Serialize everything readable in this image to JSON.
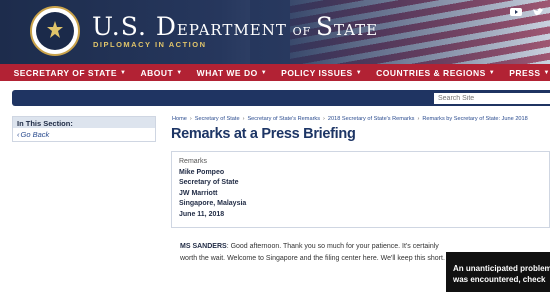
{
  "header": {
    "title_main_1": "U.S. D",
    "title_main_2": "EPARTMENT ",
    "title_of": "OF ",
    "title_state_1": "S",
    "title_state_2": "TATE",
    "tagline": "DIPLOMACY IN ACTION",
    "social_icons": [
      "youtube-icon",
      "twitter-icon"
    ]
  },
  "nav": {
    "items": [
      {
        "label": "SECRETARY OF STATE"
      },
      {
        "label": "ABOUT"
      },
      {
        "label": "WHAT WE DO"
      },
      {
        "label": "POLICY ISSUES"
      },
      {
        "label": "COUNTRIES & REGIONS"
      },
      {
        "label": "PRESS"
      }
    ]
  },
  "search": {
    "placeholder": "Search Site"
  },
  "sidebar": {
    "heading": "In This Section:",
    "back_label": "Go Back"
  },
  "breadcrumb": [
    "Home",
    "Secretary of State",
    "Secretary of State's Remarks",
    "2018 Secretary of State's Remarks",
    "Remarks by Secretary of State: June 2018"
  ],
  "page": {
    "title": "Remarks at a Press Briefing"
  },
  "info": {
    "type": "Remarks",
    "speaker": "Mike Pompeo",
    "role": "Secretary of State",
    "venue": "JW Marriott",
    "location": "Singapore, Malaysia",
    "date": "June 11, 2018"
  },
  "body": {
    "speaker": "MS SANDERS",
    "text": ": Good afternoon. Thank you so much for your patience. It's certainly worth the wait. Welcome to Singapore and the filing center here. We'll keep this short."
  },
  "toast": {
    "line1": "An unanticipated problem",
    "line2": "was encountered, check"
  }
}
